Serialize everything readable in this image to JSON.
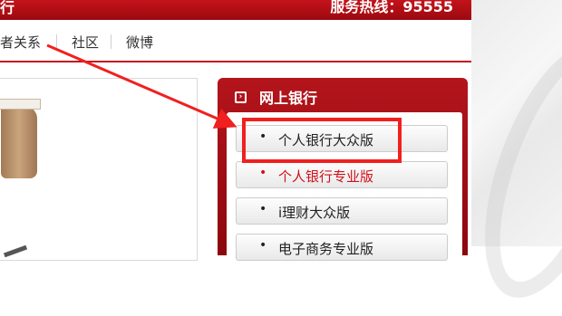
{
  "topbar": {
    "left_text": "行",
    "hotline": "服务热线：95555"
  },
  "nav": {
    "items": [
      {
        "label": "者关系"
      },
      {
        "label": "社区"
      },
      {
        "label": "微博"
      }
    ]
  },
  "online_bank": {
    "title": "网上银行",
    "links": [
      {
        "label": "个人银行大众版"
      },
      {
        "label": "个人银行专业版"
      },
      {
        "label": "i理财大众版"
      },
      {
        "label": "电子商务专业版"
      }
    ]
  },
  "colors": {
    "brand_red": "#c4121a",
    "annotation_red": "#f0201f",
    "active_link": "#d0101a"
  },
  "icons": [
    "link-icon",
    "arrow-annotation"
  ]
}
